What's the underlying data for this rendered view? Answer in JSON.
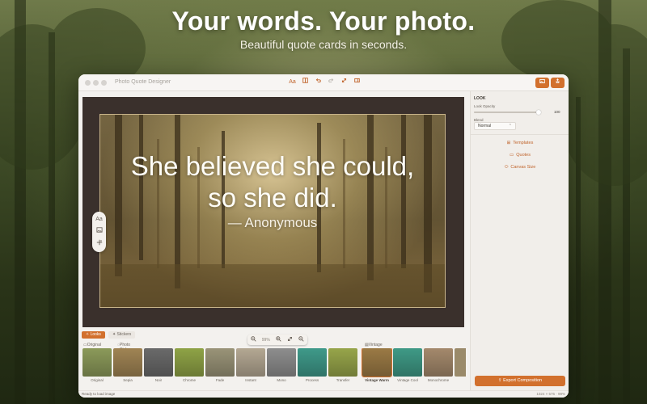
{
  "marketing": {
    "headline": "Your words. Your photo.",
    "subheadline": "Beautiful quote cards in seconds."
  },
  "window": {
    "title": "Photo Quote Designer"
  },
  "toolbar": {
    "icons": [
      "text-icon",
      "layout-icon",
      "undo-icon",
      "redo-icon",
      "expand-icon",
      "sidebar-icon"
    ],
    "text_icon_label": "Aa",
    "right_icons": [
      "photo-icon",
      "share-icon"
    ]
  },
  "canvas": {
    "quote_line1": "She believed she could,",
    "quote_line2": "so she did.",
    "author": "— Anonymous",
    "float_tool_text_label": "Aa",
    "zoom": "99%"
  },
  "bottom": {
    "tabs": [
      {
        "label": "Looks",
        "active": true
      },
      {
        "label": "Stickers",
        "active": false
      }
    ],
    "sections": {
      "original": "Original",
      "photo_styles": "Photo Styles",
      "vintage": "Vintage"
    },
    "looks": [
      {
        "name": "Original",
        "color": "#8c9a5a"
      },
      {
        "name": "Sepia",
        "color": "#a08454"
      },
      {
        "name": "Noir",
        "color": "#6a6a6a"
      },
      {
        "name": "Chrome",
        "color": "#8fa346"
      },
      {
        "name": "Fade",
        "color": "#9a9478"
      },
      {
        "name": "Instant",
        "color": "#b4a893"
      },
      {
        "name": "Mono",
        "color": "#8e8e8e"
      },
      {
        "name": "Process",
        "color": "#3f9a8a"
      },
      {
        "name": "Transfer",
        "color": "#97a54a"
      },
      {
        "name": "Vintage Warm",
        "color": "#9b7a45"
      },
      {
        "name": "Vintage Cool",
        "color": "#3f9a86"
      },
      {
        "name": "Monochrome",
        "color": "#a4896c"
      }
    ]
  },
  "panel": {
    "look_title": "LOOK",
    "opacity_label": "Look Opacity",
    "opacity_value": "100",
    "opacity_fraction": 0.97,
    "blend_label": "Blend",
    "blend_value": "Normal",
    "links": [
      {
        "label": "Templates",
        "icon": "grid-icon",
        "glyph": "⊞"
      },
      {
        "label": "Quotes",
        "icon": "chat-icon",
        "glyph": "▭"
      },
      {
        "label": "Canvas Size",
        "icon": "resize-icon",
        "glyph": "⬭"
      }
    ],
    "export_label": "Export Composition"
  },
  "status": {
    "left": "Ready to load image",
    "right": "1024 × 576 · 99%"
  },
  "colors": {
    "accent": "#d2702d",
    "canvas_border": "#3a302c"
  }
}
